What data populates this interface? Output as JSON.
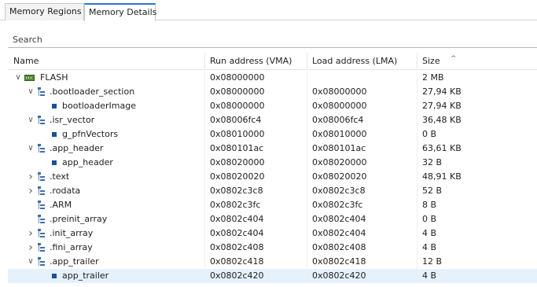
{
  "tabs": [
    {
      "label": "Memory Regions",
      "active": false
    },
    {
      "label": "Memory Details",
      "active": true
    }
  ],
  "search": {
    "placeholder": "Search"
  },
  "columns": {
    "name": "Name",
    "run": "Run address (VMA)",
    "load": "Load address (LMA)",
    "size": "Size",
    "sort_indicator": "^"
  },
  "rows": [
    {
      "name": "FLASH",
      "run": "0x08000000",
      "load": "",
      "size": "2 MB",
      "level": 0,
      "twisty": "expanded",
      "icon": "memory-chip-icon"
    },
    {
      "name": ".bootloader_section",
      "run": "0x08000000",
      "load": "0x08000000",
      "size": "27,94 KB",
      "level": 1,
      "twisty": "expanded",
      "icon": "section-icon"
    },
    {
      "name": "bootloaderImage",
      "run": "0x08000000",
      "load": "0x08000000",
      "size": "27,94 KB",
      "level": 2,
      "twisty": "none",
      "icon": "symbol-icon"
    },
    {
      "name": ".isr_vector",
      "run": "0x08006fc4",
      "load": "0x08006fc4",
      "size": "36,48 KB",
      "level": 1,
      "twisty": "expanded",
      "icon": "section-icon"
    },
    {
      "name": "g_pfnVectors",
      "run": "0x08010000",
      "load": "0x08010000",
      "size": "0 B",
      "level": 2,
      "twisty": "none",
      "icon": "symbol-icon"
    },
    {
      "name": ".app_header",
      "run": "0x080101ac",
      "load": "0x080101ac",
      "size": "63,61 KB",
      "level": 1,
      "twisty": "expanded",
      "icon": "section-icon"
    },
    {
      "name": "app_header",
      "run": "0x08020000",
      "load": "0x08020000",
      "size": "32 B",
      "level": 2,
      "twisty": "none",
      "icon": "symbol-icon"
    },
    {
      "name": ".text",
      "run": "0x08020020",
      "load": "0x08020020",
      "size": "48,91 KB",
      "level": 1,
      "twisty": "collapsed",
      "icon": "section-icon"
    },
    {
      "name": ".rodata",
      "run": "0x0802c3c8",
      "load": "0x0802c3c8",
      "size": "52 B",
      "level": 1,
      "twisty": "collapsed",
      "icon": "section-icon"
    },
    {
      "name": ".ARM",
      "run": "0x0802c3fc",
      "load": "0x0802c3fc",
      "size": "8 B",
      "level": 1,
      "twisty": "none",
      "icon": "section-icon"
    },
    {
      "name": ".preinit_array",
      "run": "0x0802c404",
      "load": "0x0802c404",
      "size": "0 B",
      "level": 1,
      "twisty": "none",
      "icon": "section-icon"
    },
    {
      "name": ".init_array",
      "run": "0x0802c404",
      "load": "0x0802c404",
      "size": "4 B",
      "level": 1,
      "twisty": "collapsed",
      "icon": "section-icon"
    },
    {
      "name": ".fini_array",
      "run": "0x0802c408",
      "load": "0x0802c408",
      "size": "4 B",
      "level": 1,
      "twisty": "collapsed",
      "icon": "section-icon"
    },
    {
      "name": ".app_trailer",
      "run": "0x0802c418",
      "load": "0x0802c418",
      "size": "12 B",
      "level": 1,
      "twisty": "expanded",
      "icon": "section-icon"
    },
    {
      "name": "app_trailer",
      "run": "0x0802c420",
      "load": "0x0802c420",
      "size": "4 B",
      "level": 2,
      "twisty": "none",
      "icon": "symbol-icon",
      "selected": true
    }
  ],
  "colors": {
    "active_tab_accent": "#2a78d2",
    "selection": "#e5f1fb"
  }
}
